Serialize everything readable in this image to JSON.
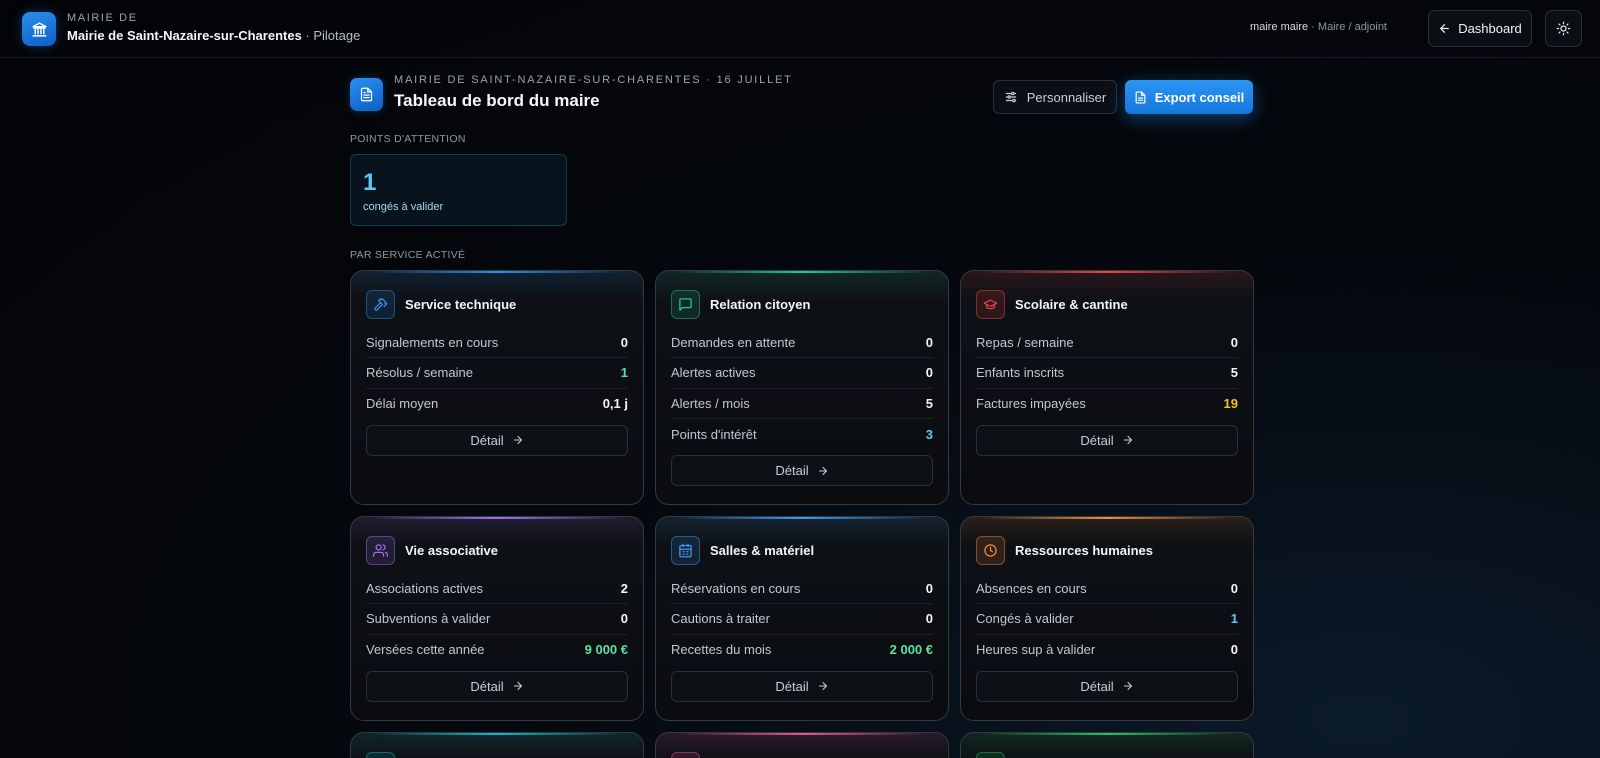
{
  "topbar": {
    "brand_sub": "MAIRIE DE",
    "brand_name": "Mairie de Saint-Nazaire-sur-Charentes",
    "brand_section": " · Pilotage",
    "user_name": "maire maire",
    "user_role": " · Maire / adjoint",
    "dashboard_label": "Dashboard"
  },
  "header": {
    "kicker": "MAIRIE DE SAINT-NAZAIRE-SUR-CHARENTES · 16 JUILLET",
    "title": "Tableau de bord du maire",
    "personnaliser_label": "Personnaliser",
    "export_label": "Export conseil"
  },
  "attention": {
    "section_label": "POINTS D'ATTENTION",
    "value": "1",
    "label": "congés à valider"
  },
  "services": {
    "section_label": "PAR SERVICE ACTIVÉ",
    "detail_label": "Détail",
    "cards": [
      {
        "title": "Service technique",
        "icon": "hammer-icon",
        "accent": "#2a8ff0",
        "metrics": [
          {
            "label": "Signalements en cours",
            "value": "0",
            "color": "#f3f5f7"
          },
          {
            "label": "Résolus / semaine",
            "value": "1",
            "color": "#5fe0a0"
          },
          {
            "label": "Délai moyen",
            "value": "0,1 j",
            "color": "#f3f5f7"
          }
        ]
      },
      {
        "title": "Relation citoyen",
        "icon": "chat-icon",
        "accent": "#20c997",
        "metrics": [
          {
            "label": "Demandes en attente",
            "value": "0",
            "color": "#f3f5f7"
          },
          {
            "label": "Alertes actives",
            "value": "0",
            "color": "#f3f5f7"
          },
          {
            "label": "Alertes / mois",
            "value": "5",
            "color": "#f3f5f7"
          },
          {
            "label": "Points d'intérêt",
            "value": "3",
            "color": "#5cc8f5"
          }
        ]
      },
      {
        "title": "Scolaire & cantine",
        "icon": "graduation-cap-icon",
        "accent": "#ef4444",
        "metrics": [
          {
            "label": "Repas / semaine",
            "value": "0",
            "color": "#f3f5f7"
          },
          {
            "label": "Enfants inscrits",
            "value": "5",
            "color": "#f3f5f7"
          },
          {
            "label": "Factures impayées",
            "value": "19",
            "color": "#fbbf24"
          }
        ]
      },
      {
        "title": "Vie associative",
        "icon": "users-icon",
        "accent": "#a070f0",
        "metrics": [
          {
            "label": "Associations actives",
            "value": "2",
            "color": "#f3f5f7"
          },
          {
            "label": "Subventions à valider",
            "value": "0",
            "color": "#f3f5f7"
          },
          {
            "label": "Versées cette année",
            "value": "9 000 €",
            "color": "#5fe0a0"
          }
        ]
      },
      {
        "title": "Salles & matériel",
        "icon": "calendar-icon",
        "accent": "#3b9cf0",
        "metrics": [
          {
            "label": "Réservations en cours",
            "value": "0",
            "color": "#f3f5f7"
          },
          {
            "label": "Cautions à traiter",
            "value": "0",
            "color": "#f3f5f7"
          },
          {
            "label": "Recettes du mois",
            "value": "2 000 €",
            "color": "#5fe0a0"
          }
        ]
      },
      {
        "title": "Ressources humaines",
        "icon": "clock-icon",
        "accent": "#f08a3c",
        "metrics": [
          {
            "label": "Absences en cours",
            "value": "0",
            "color": "#f3f5f7"
          },
          {
            "label": "Congés à valider",
            "value": "1",
            "color": "#5cc8f5"
          },
          {
            "label": "Heures sup à valider",
            "value": "0",
            "color": "#f3f5f7"
          }
        ]
      },
      {
        "title": "",
        "icon": "document-icon",
        "accent": "#14b8c4",
        "metrics": []
      },
      {
        "title": "",
        "icon": "heart-icon",
        "accent": "#e8559a",
        "metrics": []
      },
      {
        "title": "",
        "icon": "leaf-icon",
        "accent": "#22c55e",
        "metrics": []
      }
    ]
  }
}
